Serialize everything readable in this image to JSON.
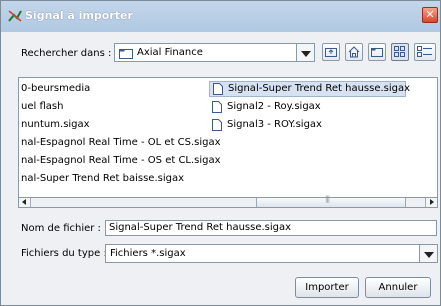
{
  "window": {
    "title": "Signal à importer"
  },
  "look_in": {
    "label": "Rechercher dans :",
    "value": "Axial Finance"
  },
  "toolbar": {
    "icons": [
      "up-folder-icon",
      "home-icon",
      "new-folder-icon",
      "list-view-icon",
      "details-view-icon"
    ]
  },
  "files": {
    "column1": [
      "0-beursmedia",
      "uel flash",
      "nuntum.sigax",
      "nal-Espagnol Real Time - OL et CS.sigax",
      "nal-Espagnol Real Time - OS et CL.sigax",
      "nal-Super Trend Ret baisse.sigax"
    ],
    "column2": [
      "Signal-Super Trend Ret hausse.sigax",
      "Signal2 - Roy.sigax",
      "Signal3 - ROY.sigax"
    ],
    "selected": "Signal-Super Trend Ret hausse.sigax"
  },
  "filename": {
    "label": "Nom de fichier :",
    "value": "Signal-Super Trend Ret hausse.sigax"
  },
  "filetype": {
    "label": "Fichiers du type :",
    "value": "Fichiers *.sigax"
  },
  "buttons": {
    "import": "Importer",
    "cancel": "Annuler"
  },
  "colors": {
    "titlebar": "#b8cfe6",
    "selection": "#d6e2f2",
    "close": "#d9462b"
  }
}
